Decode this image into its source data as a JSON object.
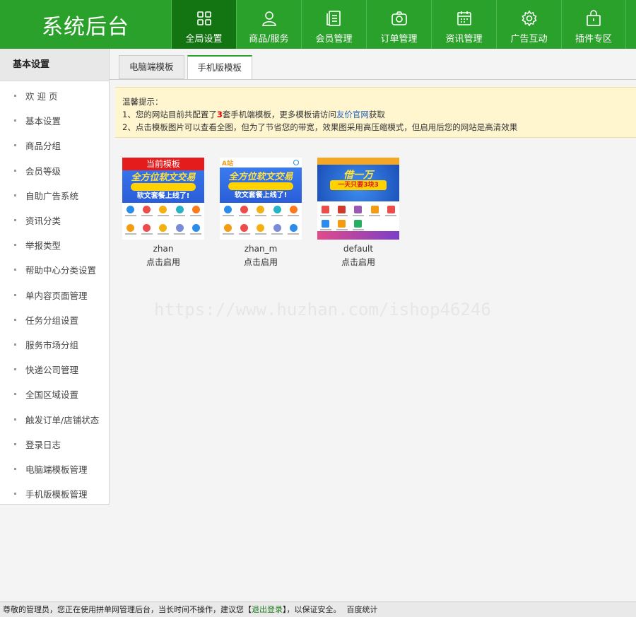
{
  "app": {
    "title": "系统后台"
  },
  "nav": [
    {
      "label": "全局设置",
      "icon": "grid-icon",
      "active": true
    },
    {
      "label": "商品/服务",
      "icon": "user-icon"
    },
    {
      "label": "会员管理",
      "icon": "document-icon"
    },
    {
      "label": "订单管理",
      "icon": "camera-icon"
    },
    {
      "label": "资讯管理",
      "icon": "calendar-icon"
    },
    {
      "label": "广告互动",
      "icon": "gear-icon"
    },
    {
      "label": "插件专区",
      "icon": "bag-icon"
    }
  ],
  "sidebar": {
    "title": "基本设置",
    "items": [
      {
        "label": "欢 迎 页"
      },
      {
        "label": "基本设置"
      },
      {
        "label": "商品分组"
      },
      {
        "label": "会员等级"
      },
      {
        "label": "自助广告系统"
      },
      {
        "label": "资讯分类"
      },
      {
        "label": "举报类型"
      },
      {
        "label": "帮助中心分类设置"
      },
      {
        "label": "单内容页面管理"
      },
      {
        "label": "任务分组设置"
      },
      {
        "label": "服务市场分组"
      },
      {
        "label": "快递公司管理"
      },
      {
        "label": "全国区域设置"
      },
      {
        "label": "触发订单/店铺状态"
      },
      {
        "label": "登录日志"
      },
      {
        "label": "电脑端模板管理"
      },
      {
        "label": "手机版模板管理"
      }
    ]
  },
  "tabs": [
    {
      "label": "电脑端模板",
      "active": false
    },
    {
      "label": "手机版模板",
      "active": true
    }
  ],
  "notice": {
    "title": "温馨提示：",
    "line1_pre": "1、您的网站目前共配置了",
    "line1_count": "3",
    "line1_mid": "套手机端模板，更多模板请访问",
    "line1_link": "友价官网",
    "line1_post": "获取",
    "line2": "2、点击模板图片可以查看全图，但为了节省您的带宽，效果图采用高压缩模式，但启用后您的网站是高清效果"
  },
  "templates": [
    {
      "name": "zhan",
      "action": "点击启用",
      "current_label": "当前模板",
      "slogan": "全方位软文交易",
      "sub": "软文套餐上线了!",
      "is_current": true
    },
    {
      "name": "zhan_m",
      "action": "点击启用",
      "brand": "A站",
      "slogan": "全方位软文交易",
      "sub": "软文套餐上线了!",
      "is_current": false
    },
    {
      "name": "default",
      "action": "点击启用",
      "slogan": "借一万",
      "sub": "一天只要3块3",
      "is_current": false
    }
  ],
  "watermark": "https://www.huzhan.com/ishop46246",
  "footer": {
    "pre": "尊敬的管理员，您正在使用拼单网管理后台，当长时间不操作，建议您【",
    "logout": "退出登录",
    "post": "】，以保证安全。",
    "stat": "百度统计"
  },
  "colors": {
    "brand": "#2aa12a",
    "nav_active": "#127512",
    "notice_bg": "#fff6d0",
    "link": "#2463c6"
  }
}
